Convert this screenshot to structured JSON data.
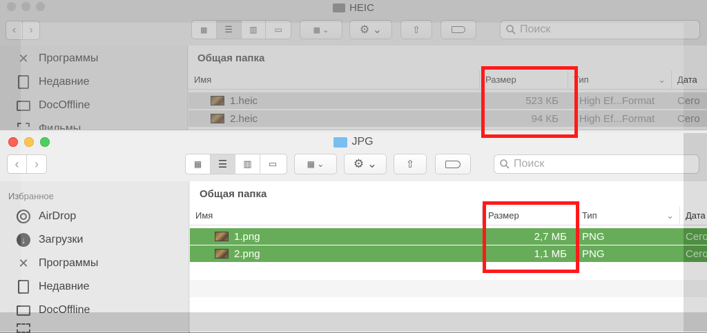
{
  "back_window": {
    "title": "HEIC",
    "search_placeholder": "Поиск",
    "sidebar_items": [
      {
        "label": "Программы",
        "icon": "apps-icon"
      },
      {
        "label": "Недавние",
        "icon": "recents-icon"
      },
      {
        "label": "DocOffline",
        "icon": "folder-icon"
      },
      {
        "label": "Фильмы",
        "icon": "film-icon"
      }
    ],
    "path_header": "Общая папка",
    "columns": {
      "name": "Имя",
      "size": "Размер",
      "type": "Тип",
      "date": "Дата"
    },
    "files": [
      {
        "name": "1.heic",
        "size": "523 КБ",
        "type": "High Ef...Format",
        "date": "Сего"
      },
      {
        "name": "2.heic",
        "size": "94 КБ",
        "type": "High Ef...Format",
        "date": "Сего"
      }
    ]
  },
  "front_window": {
    "title": "JPG",
    "search_placeholder": "Поиск",
    "sidebar_heading": "Избранное",
    "sidebar_items": [
      {
        "label": "AirDrop",
        "icon": "airdrop-icon"
      },
      {
        "label": "Загрузки",
        "icon": "downloads-icon"
      },
      {
        "label": "Программы",
        "icon": "apps-icon"
      },
      {
        "label": "Недавние",
        "icon": "recents-icon"
      },
      {
        "label": "DocOffline",
        "icon": "folder-icon"
      }
    ],
    "path_header": "Общая папка",
    "columns": {
      "name": "Имя",
      "size": "Размер",
      "type": "Тип",
      "date": "Дата"
    },
    "files": [
      {
        "name": "1.png",
        "size": "2,7 МБ",
        "type": "PNG",
        "date": "Сего"
      },
      {
        "name": "2.png",
        "size": "1,1 МБ",
        "type": "PNG",
        "date": "Сего"
      }
    ]
  },
  "colors": {
    "selection": "#4a9c3a",
    "highlight_box": "#ff1a1a",
    "close": "#fe5f57",
    "minimize": "#febc2e",
    "zoom": "#28c840"
  }
}
